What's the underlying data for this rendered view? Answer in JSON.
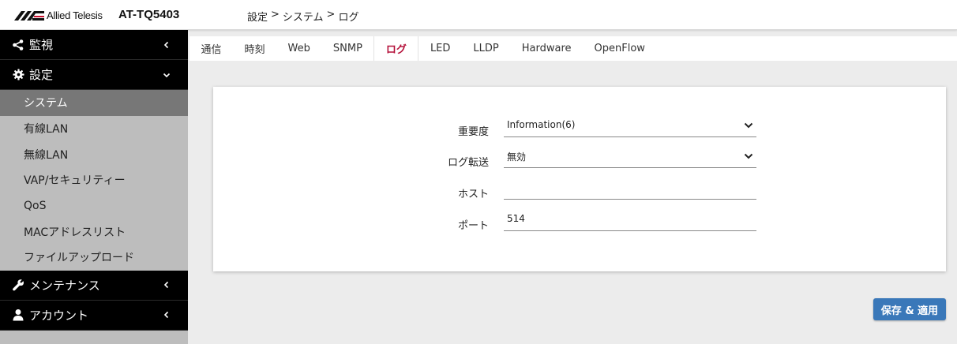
{
  "header": {
    "logo_text": "Allied Telesis",
    "model": "AT-TQ5403",
    "breadcrumb": [
      "設定",
      ">",
      "システム",
      ">",
      "ログ"
    ]
  },
  "sidebar": {
    "groups": [
      {
        "label": "監視",
        "icon": "share-icon",
        "expanded": false
      },
      {
        "label": "設定",
        "icon": "gear-icon",
        "expanded": true
      },
      {
        "label": "メンテナンス",
        "icon": "wrench-icon",
        "expanded": false
      },
      {
        "label": "アカウント",
        "icon": "user-icon",
        "expanded": false
      }
    ],
    "items": [
      "システム",
      "有線LAN",
      "無線LAN",
      "VAP/セキュリティー",
      "QoS",
      "MACアドレスリスト",
      "ファイルアップロード"
    ],
    "active_item": "システム"
  },
  "tabs": [
    "通信",
    "時刻",
    "Web",
    "SNMP",
    "ログ",
    "LED",
    "LLDP",
    "Hardware",
    "OpenFlow"
  ],
  "active_tab": "ログ",
  "form": {
    "severity": {
      "label": "重要度",
      "value": "Information(6)"
    },
    "forward": {
      "label": "ログ転送",
      "value": "無効"
    },
    "host": {
      "label": "ホスト",
      "value": ""
    },
    "port": {
      "label": "ポート",
      "value": "514"
    }
  },
  "save_button": "保存 & 適用",
  "colors": {
    "active_tab": "#b5123b",
    "button": "#3a78b9",
    "sidebar_head": "#000000",
    "active_item": "#777777"
  }
}
